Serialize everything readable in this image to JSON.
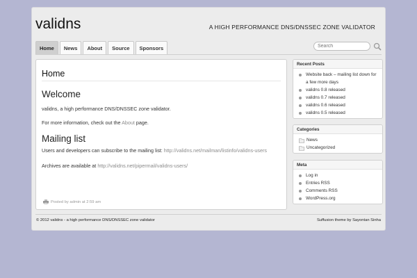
{
  "site": {
    "title": "validns",
    "description": "A HIGH PERFORMANCE DNS/DNSSEC ZONE VALIDATOR"
  },
  "nav": {
    "tabs": [
      {
        "label": "Home",
        "active": true
      },
      {
        "label": "News",
        "active": false
      },
      {
        "label": "About",
        "active": false
      },
      {
        "label": "Source",
        "active": false
      },
      {
        "label": "Sponsors",
        "active": false
      }
    ]
  },
  "search": {
    "placeholder": "Search",
    "icon": "search-icon"
  },
  "main": {
    "page_title": "Home",
    "welcome_heading": "Welcome",
    "welcome_text": "validns, a high performance DNS/DNSSEC zone validator.",
    "more_info_prefix": "For more information, check out the ",
    "more_info_link": "About",
    "more_info_suffix": " page.",
    "mailing_heading": "Mailing list",
    "subscribe_prefix": "Users and developers can subscribe to the mailing list: ",
    "subscribe_link": "http://validns.net/mailman/listinfo/validns-users",
    "archives_prefix": "Archives are available at ",
    "archives_link": "http://validns.net/pipermail/validns-users/",
    "posted_text": "Posted by admin at 2:59 am"
  },
  "sidebar": {
    "recent_posts": {
      "title": "Recent Posts",
      "items": [
        "Website back – mailing list down for a few more days",
        "validns 0.8 released",
        "validns 0.7 released",
        "validns 0.6 released",
        "validns 0.5 released"
      ]
    },
    "categories": {
      "title": "Categories",
      "items": [
        "News",
        "Uncategorized"
      ]
    },
    "meta": {
      "title": "Meta",
      "items": [
        "Log in",
        "Entries RSS",
        "Comments RSS",
        "WordPress.org"
      ]
    }
  },
  "footer": {
    "left": "© 2012 validns - a high performance DNS/DNSSEC zone validator",
    "right": "Suffusion theme by Sayontan Sinha"
  },
  "colors": {
    "background": "#b4b6d2",
    "page": "#ececec",
    "active_tab": "#cfcfcf",
    "link": "#8a8a8a"
  }
}
